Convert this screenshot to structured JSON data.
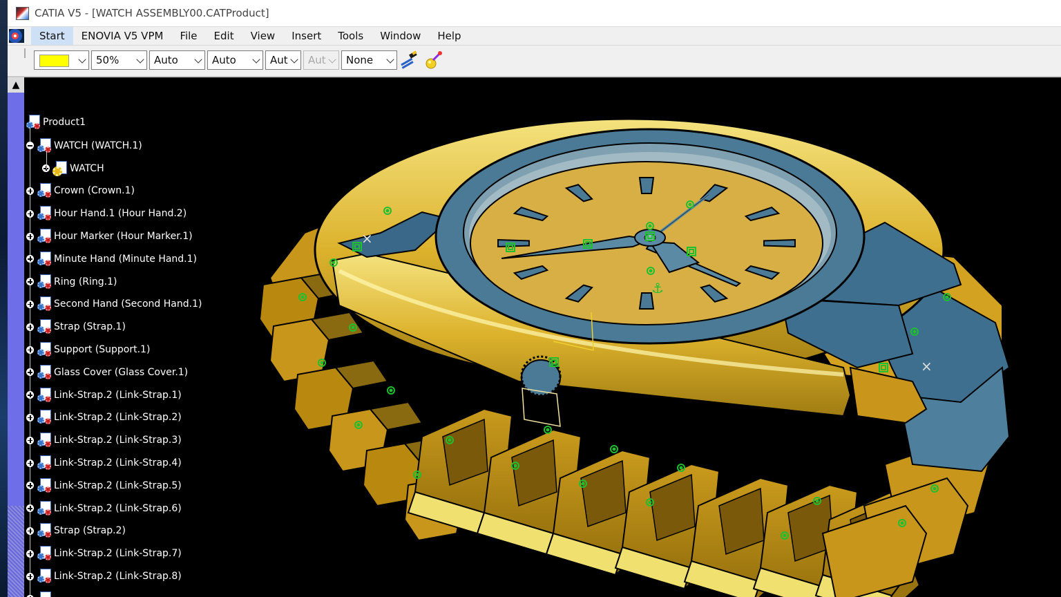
{
  "window": {
    "title": "CATIA V5 - [WATCH ASSEMBLY00.CATProduct]"
  },
  "menu": {
    "items": [
      "Start",
      "ENOVIA V5 VPM",
      "File",
      "Edit",
      "View",
      "Insert",
      "Tools",
      "Window",
      "Help"
    ],
    "active_index": 0
  },
  "toolbar": {
    "color_swatch": "#FFFF00",
    "transparency": "50%",
    "line_thickness": "Auto",
    "linetype": "Auto",
    "point_symbol": "Aut",
    "point_symbol_disabled": "Aut",
    "layer": "None",
    "icons": [
      "painter-brush-icon",
      "properties-wand-icon"
    ]
  },
  "tree": {
    "root": "Product1",
    "nodes": [
      {
        "label": "WATCH (WATCH.1)",
        "level": 1,
        "icon": "product"
      },
      {
        "label": "WATCH",
        "level": 2,
        "icon": "part"
      },
      {
        "label": "Crown (Crown.1)",
        "level": 1,
        "icon": "product"
      },
      {
        "label": "Hour Hand.1 (Hour Hand.2)",
        "level": 1,
        "icon": "product"
      },
      {
        "label": "Hour Marker (Hour Marker.1)",
        "level": 1,
        "icon": "product"
      },
      {
        "label": "Minute Hand (Minute Hand.1)",
        "level": 1,
        "icon": "product"
      },
      {
        "label": "Ring (Ring.1)",
        "level": 1,
        "icon": "product"
      },
      {
        "label": "Second Hand (Second Hand.1)",
        "level": 1,
        "icon": "product"
      },
      {
        "label": "Strap (Strap.1)",
        "level": 1,
        "icon": "product"
      },
      {
        "label": "Support (Support.1)",
        "level": 1,
        "icon": "product"
      },
      {
        "label": "Glass Cover (Glass Cover.1)",
        "level": 1,
        "icon": "product"
      },
      {
        "label": "Link-Strap.2 (Link-Strap.1)",
        "level": 1,
        "icon": "product"
      },
      {
        "label": "Link-Strap.2 (Link-Strap.2)",
        "level": 1,
        "icon": "product"
      },
      {
        "label": "Link-Strap.2 (Link-Strap.3)",
        "level": 1,
        "icon": "product"
      },
      {
        "label": "Link-Strap.2 (Link-Strap.4)",
        "level": 1,
        "icon": "product"
      },
      {
        "label": "Link-Strap.2 (Link-Strap.5)",
        "level": 1,
        "icon": "product"
      },
      {
        "label": "Link-Strap.2 (Link-Strap.6)",
        "level": 1,
        "icon": "product"
      },
      {
        "label": "Strap (Strap.2)",
        "level": 1,
        "icon": "product"
      },
      {
        "label": "Link-Strap.2 (Link-Strap.7)",
        "level": 1,
        "icon": "product"
      },
      {
        "label": "Link-Strap.2 (Link-Strap.8)",
        "level": 1,
        "icon": "product"
      },
      {
        "label": "",
        "level": 1,
        "icon": "product"
      }
    ]
  },
  "colors": {
    "gold": "#D9A520",
    "gold_light": "#F2E27A",
    "blue_steel": "#4A7A96",
    "dial": "#D8AF45",
    "constraint_green": "#1FBF2F",
    "tree_text": "#FFFFFF",
    "background": "#000000"
  }
}
